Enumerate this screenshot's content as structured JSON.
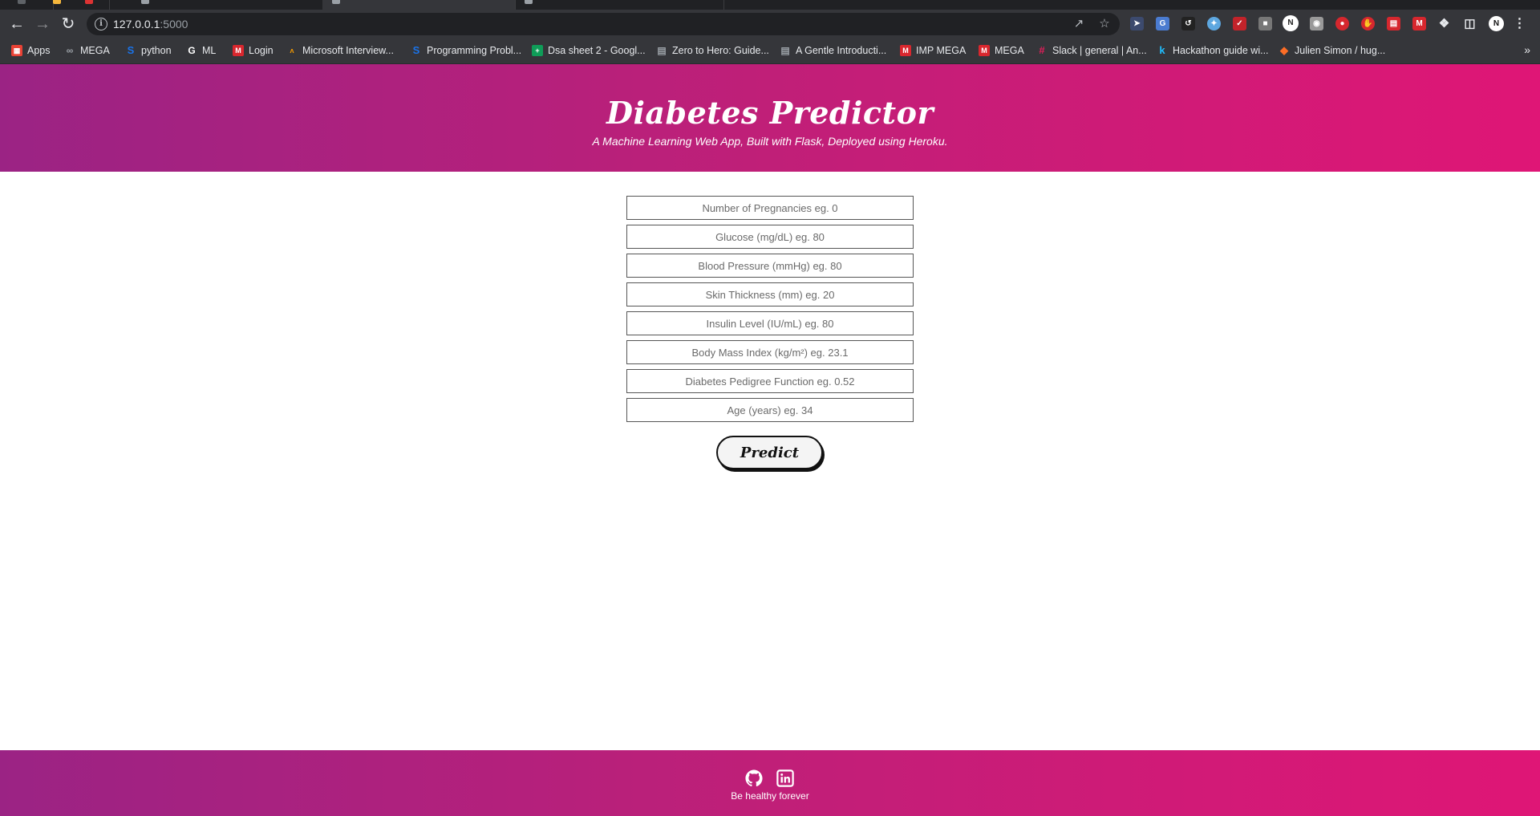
{
  "browser": {
    "url_host": "127.0.0.1",
    "url_port": ":5000",
    "bookmarks": [
      {
        "label": "Apps",
        "icon": "apps-grid-icon",
        "color": "#e94235"
      },
      {
        "label": "MEGA",
        "icon": "infinity-icon",
        "color": "#9aa0a6"
      },
      {
        "label": "python",
        "icon": "s-logo-icon",
        "color": "#1a73e8"
      },
      {
        "label": "ML",
        "icon": "google-g-icon",
        "color": "#ffffff"
      },
      {
        "label": "Login",
        "icon": "mega-m-icon",
        "color": "#d9272e"
      },
      {
        "label": "Microsoft Interview...",
        "icon": "leaf-icon",
        "color": "#f29900"
      },
      {
        "label": "Programming Probl...",
        "icon": "s-logo-icon",
        "color": "#1a73e8"
      },
      {
        "label": "Dsa sheet 2 - Googl...",
        "icon": "sheets-icon",
        "color": "#0f9d58"
      },
      {
        "label": "Zero to Hero: Guide...",
        "icon": "page-icon",
        "color": "#9aa0a6"
      },
      {
        "label": "A Gentle Introducti...",
        "icon": "page-icon",
        "color": "#9aa0a6"
      },
      {
        "label": "IMP MEGA",
        "icon": "mega-m-icon",
        "color": "#d9272e"
      },
      {
        "label": "MEGA",
        "icon": "mega-m-icon",
        "color": "#d9272e"
      },
      {
        "label": "Slack | general | An...",
        "icon": "slack-icon",
        "color": "#e01e5a"
      },
      {
        "label": "Hackathon guide wi...",
        "icon": "k-logo-icon",
        "color": "#20beff"
      },
      {
        "label": "Julien Simon / hug...",
        "icon": "gitlab-icon",
        "color": "#fc6d26"
      }
    ]
  },
  "header": {
    "title": "Diabetes Predictor",
    "subtitle": "A Machine Learning Web App, Built with Flask, Deployed using Heroku."
  },
  "form": {
    "fields": [
      {
        "placeholder": "Number of Pregnancies eg. 0"
      },
      {
        "placeholder": "Glucose (mg/dL) eg. 80"
      },
      {
        "placeholder": "Blood Pressure (mmHg) eg. 80"
      },
      {
        "placeholder": "Skin Thickness (mm) eg. 20"
      },
      {
        "placeholder": "Insulin Level (IU/mL) eg. 80"
      },
      {
        "placeholder": "Body Mass Index (kg/m²) eg. 23.1"
      },
      {
        "placeholder": "Diabetes Pedigree Function eg. 0.52"
      },
      {
        "placeholder": "Age (years) eg. 34"
      }
    ],
    "submit_label": "Predict"
  },
  "footer": {
    "tagline": "Be healthy forever"
  },
  "colors": {
    "gradient_start": "#9b2384",
    "gradient_end": "#df1676"
  }
}
